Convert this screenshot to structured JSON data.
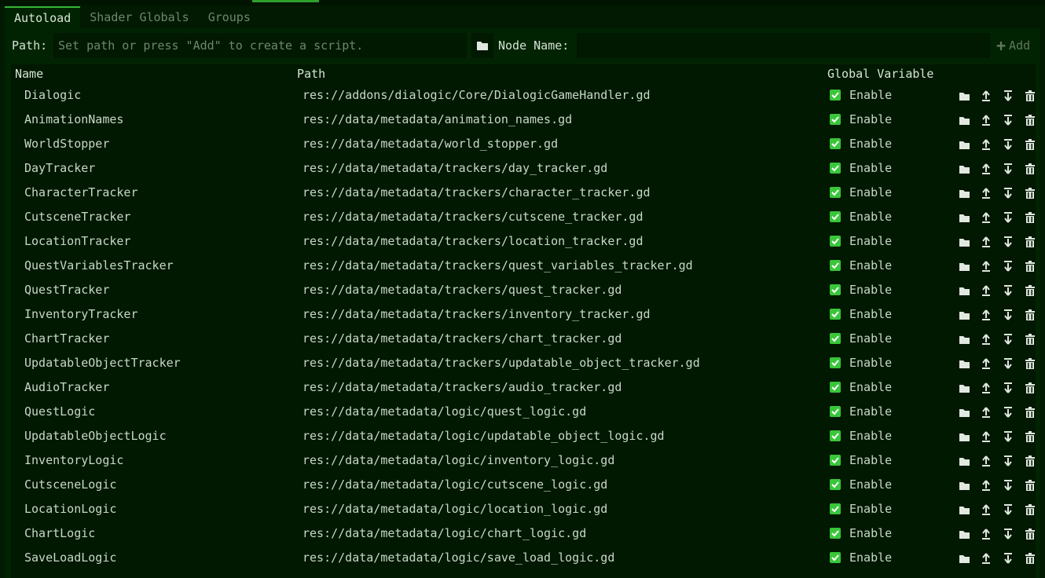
{
  "tabs": [
    {
      "label": "Autoload",
      "active": true
    },
    {
      "label": "Shader Globals",
      "active": false
    },
    {
      "label": "Groups",
      "active": false
    }
  ],
  "toolbar": {
    "path_label": "Path:",
    "path_placeholder": "Set path or press \"Add\" to create a script.",
    "node_name_label": "Node Name:",
    "node_name_value": "",
    "add_label": "Add"
  },
  "table": {
    "headers": {
      "name": "Name",
      "path": "Path",
      "global": "Global Variable"
    },
    "enable_label": "Enable",
    "rows": [
      {
        "name": "Dialogic",
        "path": "res://addons/dialogic/Core/DialogicGameHandler.gd"
      },
      {
        "name": "AnimationNames",
        "path": "res://data/metadata/animation_names.gd"
      },
      {
        "name": "WorldStopper",
        "path": "res://data/metadata/world_stopper.gd"
      },
      {
        "name": "DayTracker",
        "path": "res://data/metadata/trackers/day_tracker.gd"
      },
      {
        "name": "CharacterTracker",
        "path": "res://data/metadata/trackers/character_tracker.gd"
      },
      {
        "name": "CutsceneTracker",
        "path": "res://data/metadata/trackers/cutscene_tracker.gd"
      },
      {
        "name": "LocationTracker",
        "path": "res://data/metadata/trackers/location_tracker.gd"
      },
      {
        "name": "QuestVariablesTracker",
        "path": "res://data/metadata/trackers/quest_variables_tracker.gd"
      },
      {
        "name": "QuestTracker",
        "path": "res://data/metadata/trackers/quest_tracker.gd"
      },
      {
        "name": "InventoryTracker",
        "path": "res://data/metadata/trackers/inventory_tracker.gd"
      },
      {
        "name": "ChartTracker",
        "path": "res://data/metadata/trackers/chart_tracker.gd"
      },
      {
        "name": "UpdatableObjectTracker",
        "path": "res://data/metadata/trackers/updatable_object_tracker.gd"
      },
      {
        "name": "AudioTracker",
        "path": "res://data/metadata/trackers/audio_tracker.gd"
      },
      {
        "name": "QuestLogic",
        "path": "res://data/metadata/logic/quest_logic.gd"
      },
      {
        "name": "UpdatableObjectLogic",
        "path": "res://data/metadata/logic/updatable_object_logic.gd"
      },
      {
        "name": "InventoryLogic",
        "path": "res://data/metadata/logic/inventory_logic.gd"
      },
      {
        "name": "CutsceneLogic",
        "path": "res://data/metadata/logic/cutscene_logic.gd"
      },
      {
        "name": "LocationLogic",
        "path": "res://data/metadata/logic/location_logic.gd"
      },
      {
        "name": "ChartLogic",
        "path": "res://data/metadata/logic/chart_logic.gd"
      },
      {
        "name": "SaveLoadLogic",
        "path": "res://data/metadata/logic/save_load_logic.gd"
      }
    ]
  },
  "colors": {
    "background": "#021a02",
    "panel": "#022302",
    "accent": "#35b535",
    "checkbox": "#39c639"
  },
  "icons": [
    "folder-icon",
    "plus-icon",
    "checkbox-icon",
    "arrow-up-icon",
    "arrow-down-icon",
    "trash-icon"
  ]
}
